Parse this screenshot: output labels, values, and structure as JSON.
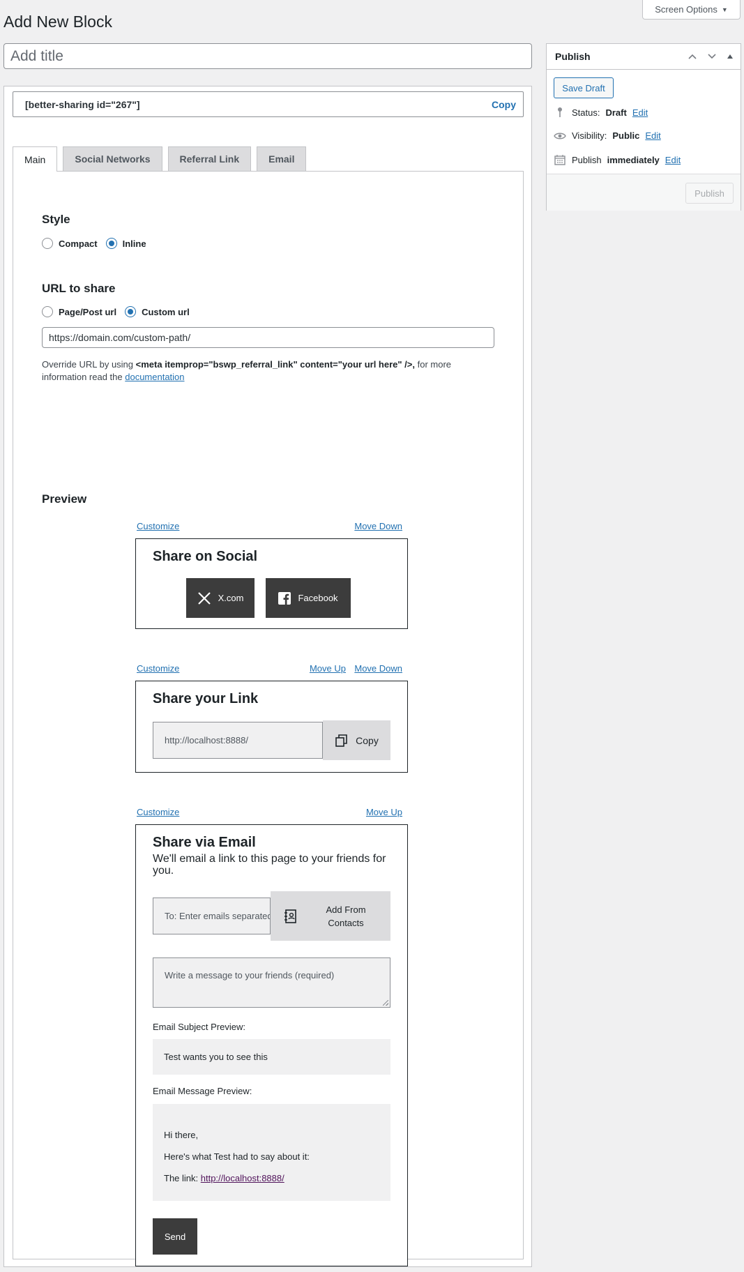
{
  "header": {
    "screen_options": "Screen Options",
    "page_title": "Add New Block",
    "title_placeholder": "Add title"
  },
  "shortcode": {
    "text": "[better-sharing id=\"267\"]",
    "copy_label": "Copy"
  },
  "tabs": [
    {
      "label": "Main",
      "active": true
    },
    {
      "label": "Social Networks",
      "active": false
    },
    {
      "label": "Referral Link",
      "active": false
    },
    {
      "label": "Email",
      "active": false
    }
  ],
  "main": {
    "style": {
      "heading": "Style",
      "options": [
        {
          "label": "Compact",
          "checked": false
        },
        {
          "label": "Inline",
          "checked": true
        }
      ]
    },
    "url": {
      "heading": "URL to share",
      "options": [
        {
          "label": "Page/Post url",
          "checked": false
        },
        {
          "label": "Custom url",
          "checked": true
        }
      ],
      "value": "https://domain.com/custom-path/",
      "note_prefix": "Override URL by using ",
      "note_code": "<meta itemprop=\"bswp_referral_link\" content=\"your url here\" />,",
      "note_suffix": " for more information read the ",
      "note_link": "documentation"
    },
    "preview_heading": "Preview"
  },
  "preview": {
    "customize": "Customize",
    "move_up": "Move Up",
    "move_down": "Move Down",
    "social": {
      "title": "Share on Social",
      "buttons": [
        {
          "label": "X.com",
          "icon": "x-logo-icon"
        },
        {
          "label": "Facebook",
          "icon": "facebook-icon"
        }
      ]
    },
    "link": {
      "title": "Share your Link",
      "url": "http://localhost:8888/",
      "copy_label": "Copy"
    },
    "email": {
      "title": "Share via Email",
      "subtitle": "We'll email a link to this page to your friends for you.",
      "to_placeholder": "To: Enter emails separated by commas",
      "add_contacts": "Add From Contacts",
      "message_placeholder": "Write a message to your friends (required)",
      "subject_label": "Email Subject Preview:",
      "subject_value": "Test wants you to see this",
      "message_label": "Email Message Preview:",
      "message_greeting": "Hi there,",
      "message_body": "Here's what Test had to say about it:",
      "message_link_prefix": "The link: ",
      "message_link": "http://localhost:8888/",
      "send_label": "Send"
    }
  },
  "publish": {
    "title": "Publish",
    "save_draft": "Save Draft",
    "status_label": "Status:",
    "status_value": "Draft",
    "visibility_label": "Visibility:",
    "visibility_value": "Public",
    "publish_label": "Publish",
    "publish_value": "immediately",
    "edit": "Edit",
    "publish_button": "Publish"
  },
  "colors": {
    "accent": "#2271b1",
    "page_bg": "#f0f0f1",
    "dark_button": "#3c3c3c"
  }
}
